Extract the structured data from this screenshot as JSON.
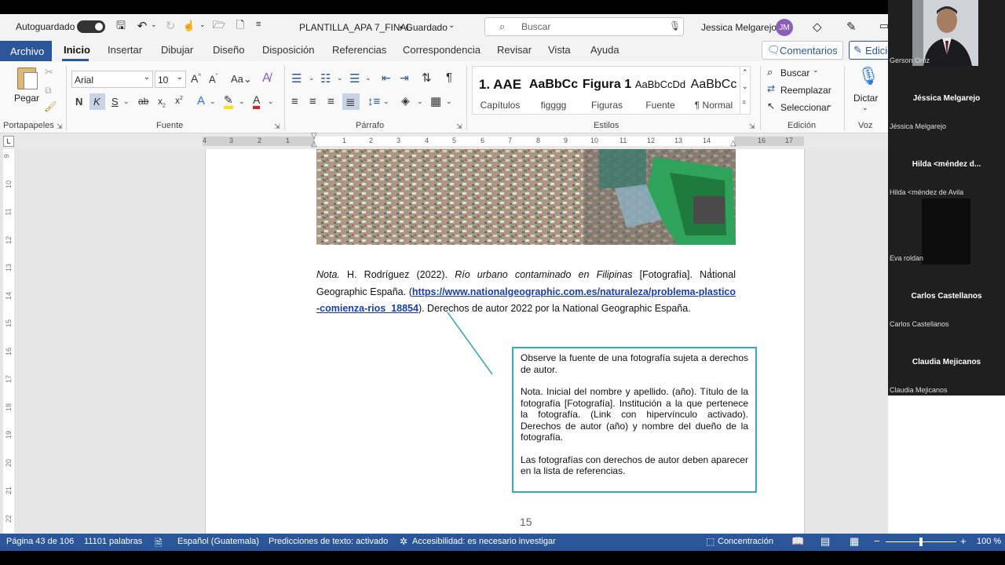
{
  "titlebar": {
    "autosave_label": "Autoguardado",
    "document_title": "PLANTILLA_APA 7_FINAL",
    "status": "• Guardado",
    "search_placeholder": "Buscar",
    "user_name": "Jessica Melgarejo",
    "user_initials": "JM"
  },
  "tabs": [
    "Archivo",
    "Inicio",
    "Insertar",
    "Dibujar",
    "Diseño",
    "Disposición",
    "Referencias",
    "Correspondencia",
    "Revisar",
    "Vista",
    "Ayuda"
  ],
  "tab_actions": {
    "comments": "Comentarios",
    "editing": "Edició"
  },
  "ribbon": {
    "clipboard": {
      "paste": "Pegar",
      "label": "Portapapeles"
    },
    "font": {
      "name": "Arial",
      "size": "10",
      "label": "Fuente",
      "bold": "N",
      "italic": "K",
      "underline": "S"
    },
    "paragraph": {
      "label": "Párrafo"
    },
    "styles": {
      "label": "Estilos",
      "items": [
        {
          "sample": "1. AAE",
          "name": "Capítulos"
        },
        {
          "sample": "AaBbCc",
          "name": "figggg"
        },
        {
          "sample": "Figura 1",
          "name": "Figuras"
        },
        {
          "sample": "AaBbCcDd",
          "name": "Fuente"
        },
        {
          "sample": "AaBbCc",
          "name": "¶ Normal"
        }
      ]
    },
    "editing": {
      "label": "Edición",
      "find": "Buscar",
      "replace": "Reemplazar",
      "select": "Seleccionar"
    },
    "voice": {
      "label": "Voz",
      "dictate": "Dictar"
    }
  },
  "ruler": {
    "numbers": [
      "4",
      "3",
      "2",
      "1",
      "1",
      "2",
      "3",
      "4",
      "5",
      "6",
      "7",
      "8",
      "9",
      "10",
      "11",
      "12",
      "13",
      "14",
      "16",
      "17"
    ],
    "vertical": [
      "9",
      "10",
      "11",
      "12",
      "13",
      "14",
      "15",
      "16",
      "17",
      "18",
      "19",
      "20",
      "21",
      "22"
    ]
  },
  "document": {
    "note_label": "Nota.",
    "note_author": "H. Rodríguez (2022).",
    "note_title": "Río urbano contaminado en Filipinas",
    "note_after_title": "[Fotografía]. National Geographic España. (",
    "note_link": "https://www.nationalgeographic.com.es/naturaleza/problema-plastico-comienza-rios_18854",
    "note_tail": "). Derechos de autor 2022 por la National Geographic España.",
    "callout_p1": "Observe la fuente de una fotografía sujeta a derechos de autor.",
    "callout_p2": "Nota. Inicial del nombre y apellido. (año). Título de la fotografía [Fotografía]. Institución a la que pertenece la fotografía. (Link con hipervínculo activado). Derechos de autor (año) y nombre del dueño de la fotografía.",
    "callout_p3": "Las fotografías con derechos de autor deben aparecer en la lista de referencias.",
    "page_number": "15"
  },
  "statusbar": {
    "page": "Página 43 de 106",
    "words": "11101 palabras",
    "language": "Español (Guatemala)",
    "predictions": "Predicciones de texto: activado",
    "accessibility": "Accesibilidad: es necesario investigar",
    "focus": "Concentración",
    "zoom": "100 %"
  },
  "participants": [
    {
      "name": "",
      "label": "Gerson Ortiz",
      "video": true
    },
    {
      "name": "Jéssica Melgarejo",
      "label": "Jéssica Melgarejo"
    },
    {
      "name": "Hilda <méndez d...",
      "label": "Hilda <méndez de Avila"
    },
    {
      "name": "",
      "label": "Eva roldan"
    },
    {
      "name": "Carlos Castellanos",
      "label": "Carlos Castellanos"
    },
    {
      "name": "Claudia Mejicanos",
      "label": "Claudia Mejicanos"
    }
  ],
  "colors": {
    "accent": "#2b579a",
    "link": "#1a3fa8",
    "callout_border": "#3aa7b4"
  }
}
